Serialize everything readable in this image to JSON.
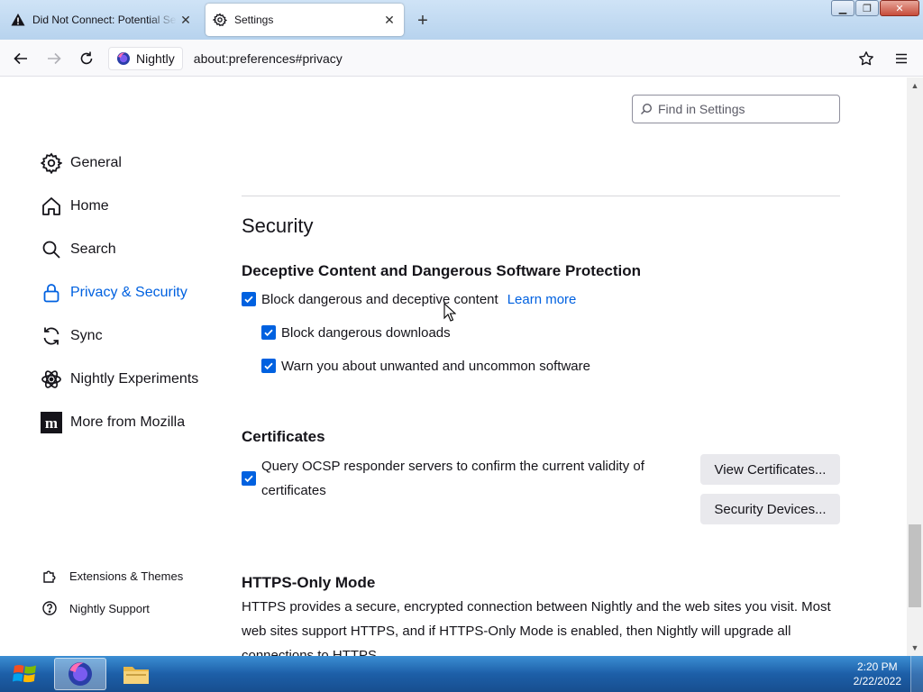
{
  "browser": {
    "tabs": [
      {
        "title": "Did Not Connect: Potential Security Issue",
        "icon": "warning-icon",
        "active": false
      },
      {
        "title": "Settings",
        "icon": "gear-icon",
        "active": true
      }
    ],
    "url_identity": "Nightly",
    "url": "about:preferences#privacy"
  },
  "settings": {
    "search_placeholder": "Find in Settings",
    "nav": [
      {
        "label": "General",
        "icon": "gear-icon"
      },
      {
        "label": "Home",
        "icon": "home-icon"
      },
      {
        "label": "Search",
        "icon": "search-icon"
      },
      {
        "label": "Privacy & Security",
        "icon": "lock-icon",
        "selected": true
      },
      {
        "label": "Sync",
        "icon": "sync-icon"
      },
      {
        "label": "Nightly Experiments",
        "icon": "flask-icon"
      },
      {
        "label": "More from Mozilla",
        "icon": "mozilla-m-icon"
      }
    ],
    "footer": [
      {
        "label": "Extensions & Themes",
        "icon": "puzzle-icon"
      },
      {
        "label": "Nightly Support",
        "icon": "help-icon"
      }
    ],
    "section_title": "Security",
    "deceptive": {
      "heading": "Deceptive Content and Dangerous Software Protection",
      "block_label": "Block dangerous and deceptive content",
      "learn_more": "Learn more",
      "downloads_label": "Block dangerous downloads",
      "warn_label": "Warn you about unwanted and uncommon software"
    },
    "certificates": {
      "heading": "Certificates",
      "ocsp_label": "Query OCSP responder servers to confirm the current validity of certificates",
      "view_button": "View Certificates...",
      "devices_button": "Security Devices..."
    },
    "https": {
      "heading": "HTTPS-Only Mode",
      "text": "HTTPS provides a secure, encrypted connection between Nightly and the web sites you visit. Most web sites support HTTPS, and if HTTPS-Only Mode is enabled, then Nightly will upgrade all connections to HTTPS."
    }
  },
  "taskbar": {
    "time": "2:20 PM",
    "date": "2/22/2022"
  },
  "colors": {
    "accent": "#0061e0",
    "text": "#15141a",
    "button_bg": "#e9e9ed"
  }
}
